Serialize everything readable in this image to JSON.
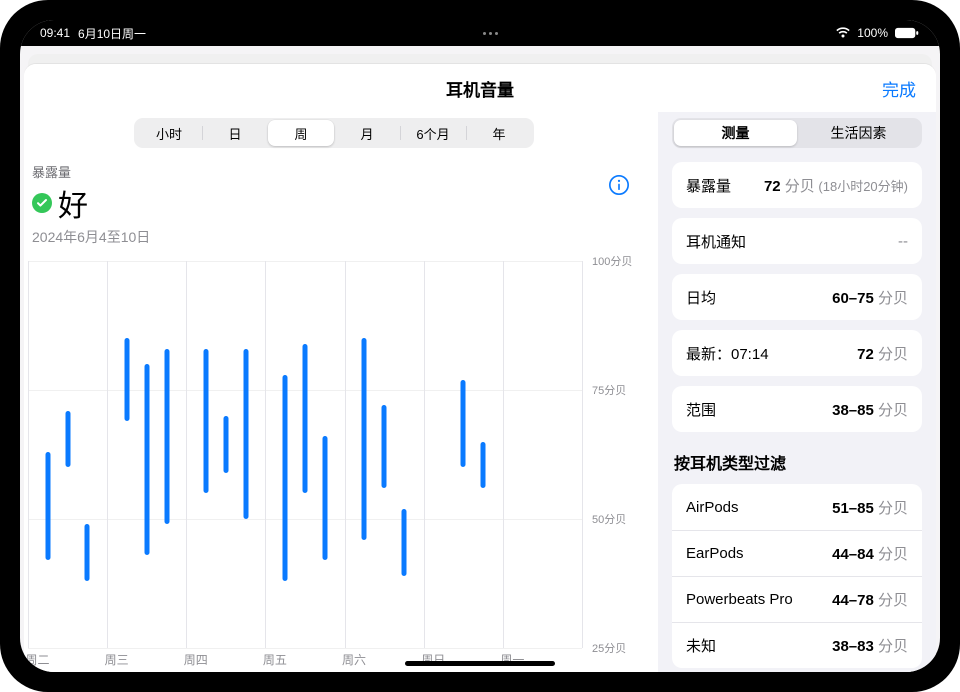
{
  "status": {
    "time": "09:41",
    "date": "6月10日周一",
    "battery_text": "100%"
  },
  "header": {
    "title": "耳机音量",
    "done": "完成"
  },
  "time_segments": {
    "items": [
      "小时",
      "日",
      "周",
      "月",
      "6个月",
      "年"
    ],
    "selected_index": 2
  },
  "summary": {
    "label": "暴露量",
    "status_text": "好",
    "date_range": "2024年6月4至10日"
  },
  "side_segments": {
    "items": [
      "测量",
      "生活因素"
    ],
    "selected_index": 0
  },
  "metrics": [
    {
      "label": "暴露量",
      "value": "72",
      "unit": "分贝",
      "detail": "(18小时20分钟)"
    },
    {
      "label": "耳机通知",
      "value": "--",
      "unit": "",
      "detail": ""
    },
    {
      "label": "日均",
      "value": "60–75",
      "unit": "分贝",
      "detail": ""
    },
    {
      "label": "最新：07:14",
      "value": "72",
      "unit": "分贝",
      "detail": ""
    },
    {
      "label": "范围",
      "value": "38–85",
      "unit": "分贝",
      "detail": ""
    }
  ],
  "filter_title": "按耳机类型过滤",
  "filters": [
    {
      "label": "AirPods",
      "value": "51–85",
      "unit": "分贝"
    },
    {
      "label": "EarPods",
      "value": "44–84",
      "unit": "分贝"
    },
    {
      "label": "Powerbeats Pro",
      "value": "44–78",
      "unit": "分贝"
    },
    {
      "label": "未知",
      "value": "38–83",
      "unit": "分贝"
    }
  ],
  "chart_data": {
    "type": "range-bar",
    "title": "耳机音量 – 暴露量 – 周",
    "ylabel": "分贝",
    "ylim": [
      25,
      100
    ],
    "y_ticks": [
      25,
      50,
      75,
      100
    ],
    "y_tick_label_suffix": "分贝",
    "categories": [
      "周二",
      "周三",
      "周四",
      "周五",
      "周六",
      "周日",
      "周一"
    ],
    "series": [
      {
        "name": "headphone-audio-level",
        "per_category_subbars": 3,
        "data": [
          [
            [
              42,
              63
            ],
            [
              60,
              71
            ],
            [
              38,
              49
            ]
          ],
          [
            [
              69,
              85
            ],
            [
              43,
              80
            ],
            [
              49,
              83
            ]
          ],
          [
            [
              55,
              83
            ],
            [
              59,
              70
            ],
            [
              50,
              83
            ]
          ],
          [
            [
              38,
              78
            ],
            [
              55,
              84
            ],
            [
              42,
              66
            ]
          ],
          [
            [
              46,
              85
            ],
            [
              56,
              72
            ],
            [
              39,
              52
            ]
          ],
          [
            [],
            [
              60,
              77
            ],
            [
              56,
              65
            ]
          ],
          [
            [],
            [],
            []
          ]
        ]
      }
    ]
  }
}
